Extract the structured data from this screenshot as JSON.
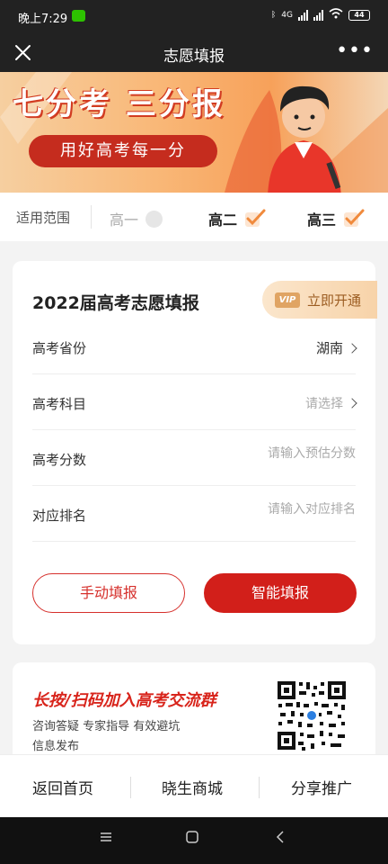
{
  "status": {
    "time": "晚上7:29",
    "signal": "4G",
    "battery": "44"
  },
  "titlebar": {
    "title": "志愿填报",
    "more": "•••"
  },
  "banner": {
    "headline": "七分考 三分报",
    "subline": "用好高考每一分"
  },
  "range": {
    "label": "适用范围",
    "grades": [
      {
        "label": "高一",
        "selected": false
      },
      {
        "label": "高二",
        "selected": true
      },
      {
        "label": "高三",
        "selected": true
      }
    ]
  },
  "form": {
    "title": "2022届高考志愿填报",
    "vip_badge": "VIP",
    "vip_label": "立即开通",
    "rows": [
      {
        "label": "高考省份",
        "value": "湖南"
      },
      {
        "label": "高考科目",
        "value": "请选择"
      },
      {
        "label": "高考分数",
        "placeholder": "请输入预估分数"
      },
      {
        "label": "对应排名",
        "placeholder": "请输入对应排名"
      }
    ],
    "manual_button": "手动填报",
    "smart_button": "智能填报"
  },
  "group": {
    "title": "长按/扫码加入高考交流群",
    "line1": "咨询答疑 专家指导 有效避坑",
    "line2": "信息发布"
  },
  "bottom_nav": [
    "返回首页",
    "晓生商城",
    "分享推广"
  ],
  "colors": {
    "accent": "#d21f1a",
    "check": "#f08a3c"
  }
}
